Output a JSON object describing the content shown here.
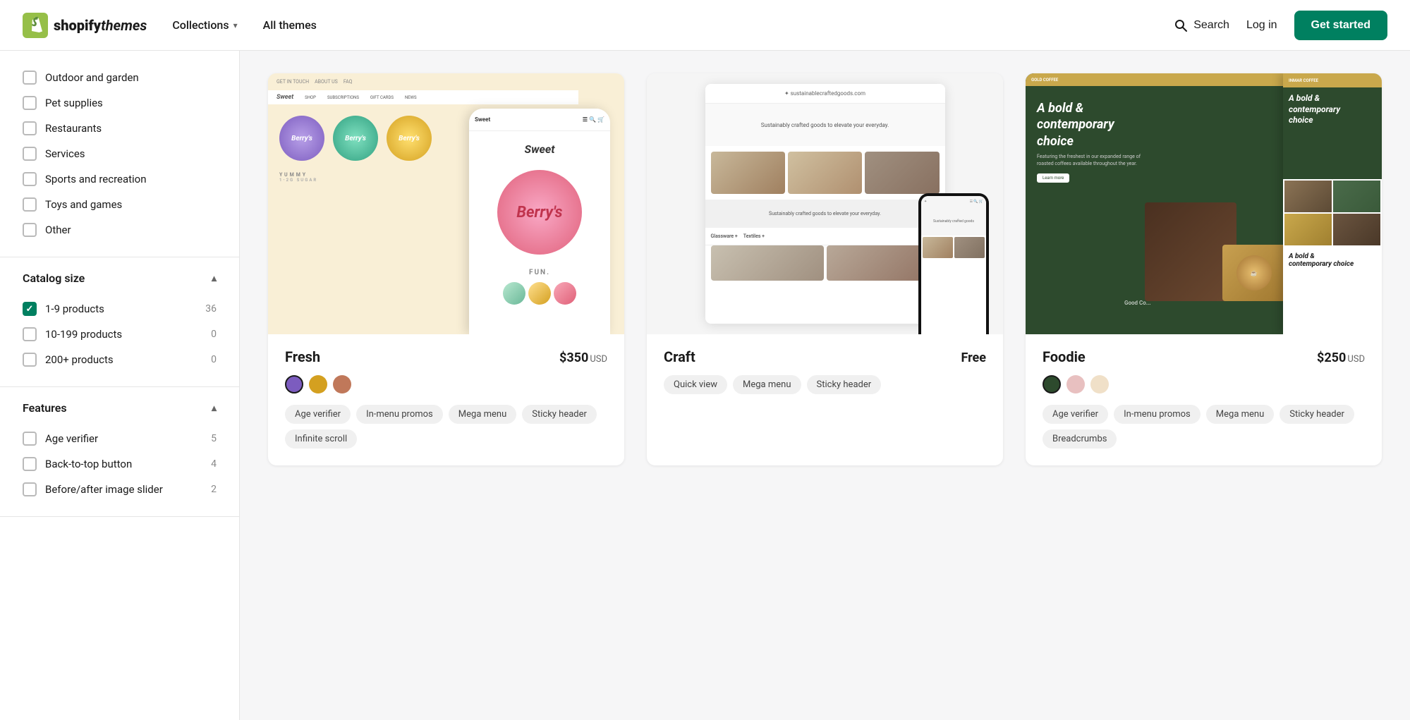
{
  "header": {
    "logo_text": "shopify",
    "logo_suffix": "themes",
    "collections_label": "Collections",
    "all_themes_label": "All themes",
    "search_label": "Search",
    "login_label": "Log in",
    "get_started_label": "Get started"
  },
  "sidebar": {
    "categories": {
      "unchecked_items": [
        "Outdoor and garden",
        "Pet supplies",
        "Restaurants",
        "Services",
        "Sports and recreation",
        "Toys and games",
        "Other"
      ]
    },
    "catalog_size": {
      "title": "Catalog size",
      "items": [
        {
          "label": "1-9 products",
          "count": "36",
          "checked": true
        },
        {
          "label": "10-199 products",
          "count": "0",
          "checked": false
        },
        {
          "label": "200+ products",
          "count": "0",
          "checked": false
        }
      ]
    },
    "features": {
      "title": "Features",
      "items": [
        {
          "label": "Age verifier",
          "count": "5",
          "checked": false
        },
        {
          "label": "Back-to-top button",
          "count": "4",
          "checked": false
        },
        {
          "label": "Before/after image slider",
          "count": "2",
          "checked": false
        }
      ]
    }
  },
  "themes": [
    {
      "name": "Fresh",
      "price": "$350",
      "price_currency": "USD",
      "is_free": false,
      "swatches": [
        {
          "color": "#7c5cbf",
          "active": true
        },
        {
          "color": "#d4a020",
          "active": false
        },
        {
          "color": "#c0785a",
          "active": false
        }
      ],
      "tags": [
        "Age verifier",
        "In-menu promos",
        "Mega menu",
        "Sticky header",
        "Infinite scroll"
      ]
    },
    {
      "name": "Craft",
      "price": "Free",
      "is_free": true,
      "swatches": [],
      "tags": [
        "Quick view",
        "Mega menu",
        "Sticky header"
      ]
    },
    {
      "name": "Foodie",
      "price": "$250",
      "price_currency": "USD",
      "is_free": false,
      "swatches": [
        {
          "color": "#2d4a2d",
          "active": true
        },
        {
          "color": "#e8c0c0",
          "active": false
        },
        {
          "color": "#f0e0c8",
          "active": false
        }
      ],
      "tags": [
        "Age verifier",
        "In-menu promos",
        "Mega menu",
        "Sticky header",
        "Breadcrumbs"
      ]
    }
  ]
}
